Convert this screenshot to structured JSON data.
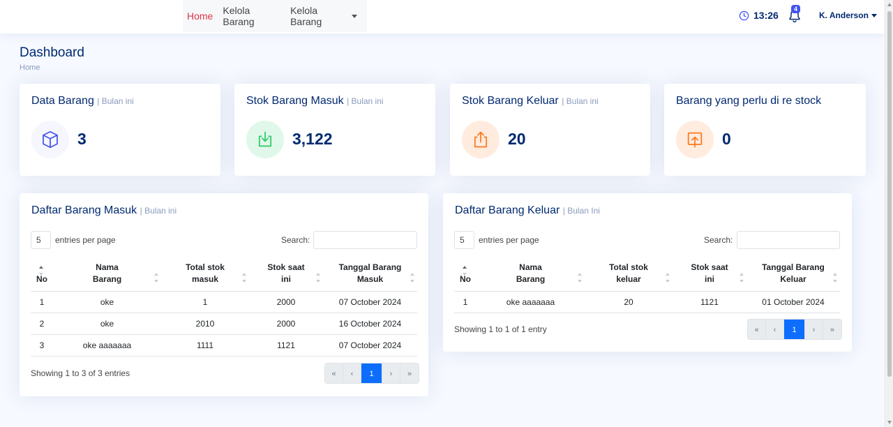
{
  "nav": {
    "home": "Home",
    "kelola_barang": "Kelola Barang",
    "kelola_barang_dropdown": "Kelola Barang"
  },
  "header": {
    "time": "13:26",
    "notification_count": "4",
    "user_name": "K. Anderson"
  },
  "page": {
    "title": "Dashboard",
    "breadcrumb": "Home"
  },
  "cards": [
    {
      "title": "Data Barang",
      "subtitle": "| Bulan ini",
      "value": "3",
      "icon": "box-icon",
      "color": "#4154f1"
    },
    {
      "title": "Stok Barang Masuk",
      "subtitle": "| Bulan ini",
      "value": "3,122",
      "icon": "download-icon",
      "color": "#2eca6a"
    },
    {
      "title": "Stok Barang Keluar",
      "subtitle": "| Bulan ini",
      "value": "20",
      "icon": "upload-icon",
      "color": "#ff771d"
    },
    {
      "title": "Barang yang perlu di re stock",
      "subtitle": "",
      "value": "0",
      "icon": "restock-icon",
      "color": "#ff771d"
    }
  ],
  "masuk": {
    "title": "Daftar Barang Masuk",
    "subtitle": "| Bulan ini",
    "per_page": "5",
    "per_page_label": "entries per page",
    "search_label": "Search:",
    "columns": [
      "No",
      "Nama Barang",
      "Total stok masuk",
      "Stok saat ini",
      "Tanggal Barang Masuk"
    ],
    "rows": [
      [
        "1",
        "oke",
        "1",
        "2000",
        "07 October 2024"
      ],
      [
        "2",
        "oke",
        "2010",
        "2000",
        "16 October 2024"
      ],
      [
        "3",
        "oke aaaaaaa",
        "1111",
        "1121",
        "07 October 2024"
      ]
    ],
    "showing": "Showing 1 to 3 of 3 entries",
    "pager": [
      "«",
      "‹",
      "1",
      "›",
      "»"
    ]
  },
  "keluar": {
    "title": "Daftar Barang Keluar",
    "subtitle": "| Bulan Ini",
    "per_page": "5",
    "per_page_label": "entries per page",
    "search_label": "Search:",
    "columns": [
      "No",
      "Nama Barang",
      "Total stok keluar",
      "Stok saat ini",
      "Tanggal Barang Keluar"
    ],
    "rows": [
      [
        "1",
        "oke aaaaaaa",
        "20",
        "1121",
        "01 October 2024"
      ]
    ],
    "showing": "Showing 1 to 1 of 1 entry",
    "pager": [
      "«",
      "‹",
      "1",
      "›",
      "»"
    ]
  }
}
